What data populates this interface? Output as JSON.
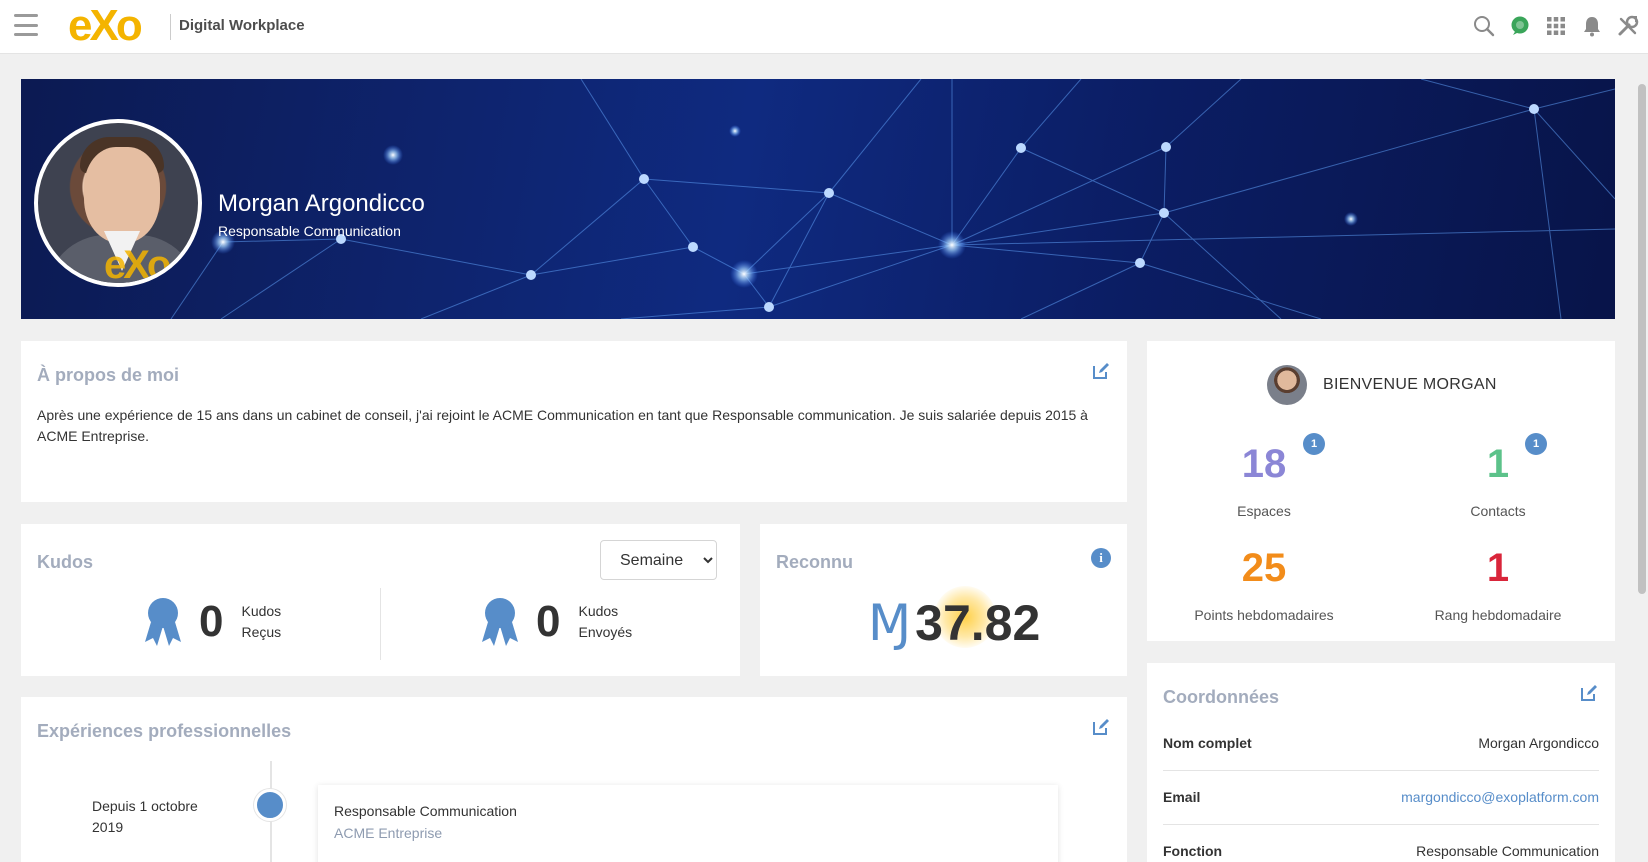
{
  "topbar": {
    "logo_text": "eXo",
    "app_name": "Digital Workplace",
    "icons": [
      "menu-icon",
      "search-icon",
      "chat-icon",
      "apps-icon",
      "bell-icon",
      "tools-icon"
    ]
  },
  "profile": {
    "name": "Morgan Argondicco",
    "role": "Responsable Communication",
    "avatar_mark": "eXo"
  },
  "about": {
    "title": "À propos de moi",
    "text": "Après une expérience de 15 ans dans un cabinet de conseil, j'ai rejoint le ACME Communication en tant que Responsable communication. Je suis salariée depuis 2015 à ACME Entreprise."
  },
  "kudos": {
    "title": "Kudos",
    "period": "Semaine",
    "received": {
      "count": "0",
      "line1": "Kudos",
      "line2": "Reçus"
    },
    "sent": {
      "count": "0",
      "line1": "Kudos",
      "line2": "Envoyés"
    }
  },
  "reconnu": {
    "title": "Reconnu",
    "currency": "Ɱ",
    "value": "37.82"
  },
  "experiences": {
    "title": "Expériences professionnelles",
    "items": [
      {
        "date": "Depuis 1 octobre 2019",
        "title": "Responsable Communication",
        "company": "ACME Entreprise"
      }
    ]
  },
  "welcome": {
    "title": "BIENVENUE MORGAN",
    "stats": [
      {
        "value": "18",
        "label": "Espaces",
        "badge": "1",
        "color": "#8b86d6"
      },
      {
        "value": "1",
        "label": "Contacts",
        "badge": "1",
        "color": "#5cc28a"
      },
      {
        "value": "25",
        "label": "Points hebdomadaires",
        "badge": "",
        "color": "#f28c1a"
      },
      {
        "value": "1",
        "label": "Rang hebdomadaire",
        "badge": "",
        "color": "#d9253a"
      }
    ]
  },
  "coords": {
    "title": "Coordonnées",
    "rows": [
      {
        "key": "Nom complet",
        "value": "Morgan Argondicco"
      },
      {
        "key": "Email",
        "value": "margondicco@exoplatform.com"
      },
      {
        "key": "Fonction",
        "value": "Responsable Communication"
      }
    ]
  },
  "colors": {
    "accent": "#578dc9",
    "logo": "#f4b400",
    "banner": "#0f2a80"
  }
}
